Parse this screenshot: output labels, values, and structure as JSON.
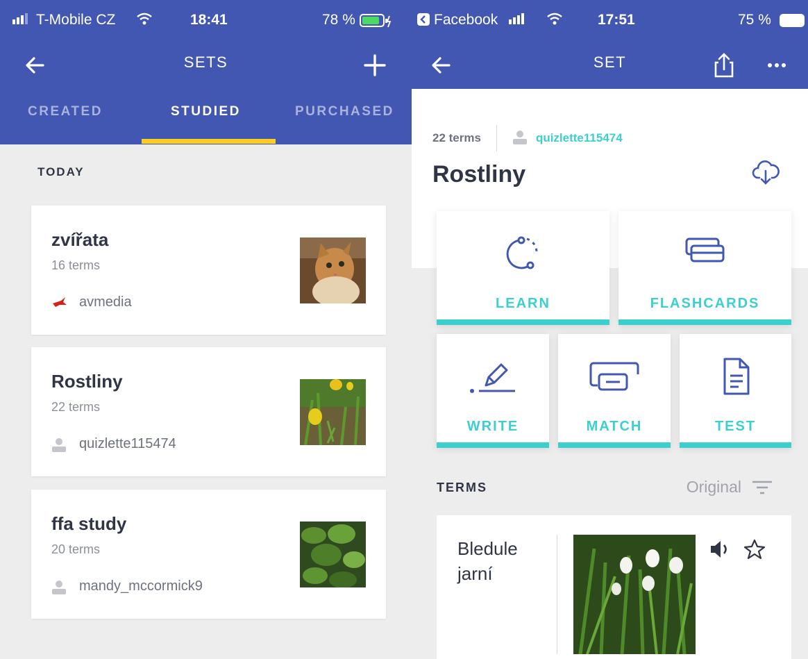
{
  "left_screen": {
    "status": {
      "carrier": "T-Mobile CZ",
      "time": "18:41",
      "battery": "78 %"
    },
    "nav": {
      "title": "SETS"
    },
    "tabs": [
      {
        "label": "CREATED",
        "active": false
      },
      {
        "label": "STUDIED",
        "active": true
      },
      {
        "label": "PURCHASED",
        "active": false
      }
    ],
    "section": "TODAY",
    "sets": [
      {
        "title": "zvířata",
        "count": "16 terms",
        "user": "avmedia",
        "user_icon": "avmedia-logo-icon",
        "thumb": "cat-photo"
      },
      {
        "title": "Rostliny",
        "count": "22 terms",
        "user": "quizlette115474",
        "user_icon": "user-icon",
        "thumb": "tulip-photo"
      },
      {
        "title": "ffa study",
        "count": "20 terms",
        "user": "mandy_mccormick9",
        "user_icon": "user-icon",
        "thumb": "jade-plant-photo"
      }
    ]
  },
  "right_screen": {
    "status": {
      "back_app": "Facebook",
      "time": "17:51",
      "battery": "75 %"
    },
    "nav": {
      "title": "SET"
    },
    "set": {
      "count": "22 terms",
      "creator": "quizlette115474",
      "name": "Rostliny"
    },
    "modes": {
      "learn": "LEARN",
      "flashcards": "FLASHCARDS",
      "write": "WRITE",
      "match": "MATCH",
      "test": "TEST"
    },
    "terms_section": {
      "label": "TERMS",
      "sort": "Original"
    },
    "terms": [
      {
        "word": "Bledule jarní",
        "image": "snowflake-flower-photo"
      }
    ]
  },
  "colors": {
    "brand": "#4257b2",
    "accent": "#3ccfcf",
    "tab_indicator": "#ffcd1f",
    "text": "#303545"
  }
}
